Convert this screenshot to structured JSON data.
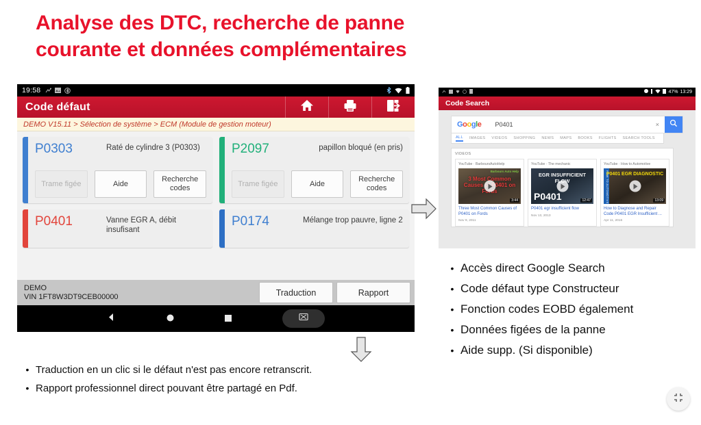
{
  "slide": {
    "title_line1": "Analyse des DTC, recherche de panne",
    "title_line2": "courante et données complémentaires",
    "title_color": "#e8122b"
  },
  "tablet": {
    "status_bar": {
      "clock": "19:58"
    },
    "header": {
      "title": "Code défaut"
    },
    "breadcrumb": "DEMO V15.11 > Sélection de système > ECM (Module de gestion moteur)",
    "dtc_cards": [
      {
        "code": "P0303",
        "description": "Raté de cylindre 3 (P0303)",
        "accent": "#3f7fd0",
        "code_color": "#3f7fd0",
        "buttons": {
          "freeze": "Trame figée",
          "help": "Aide",
          "search": "Recherche codes"
        }
      },
      {
        "code": "P2097",
        "description": "papillon bloqué (en pris)",
        "accent": "#21b07a",
        "code_color": "#21b07a",
        "buttons": {
          "freeze": "Trame figée",
          "help": "Aide",
          "search": "Recherche codes"
        }
      },
      {
        "code": "P0401",
        "description": "Vanne EGR A, débit insufisant",
        "accent": "#e2453c",
        "code_color": "#e2453c"
      },
      {
        "code": "P0174",
        "description": "Mélange trop pauvre, ligne 2",
        "accent": "#2d6fc4",
        "code_color": "#3f7fd0"
      }
    ],
    "footer": {
      "vehicle_line1": "DEMO",
      "vehicle_line2": "VIN 1FT8W3DT9CEB00000",
      "translate_label": "Traduction",
      "report_label": "Rapport"
    }
  },
  "phone": {
    "status_bar": {
      "battery": "47%",
      "clock": "13:29"
    },
    "header": {
      "title": "Code Search"
    },
    "search": {
      "logo_letters": [
        "G",
        "o",
        "o",
        "g",
        "l",
        "e"
      ],
      "query": "P0401",
      "clear_label": "×"
    },
    "tabs": [
      {
        "label": "ALL",
        "active": true
      },
      {
        "label": "IMAGES",
        "active": false
      },
      {
        "label": "VIDEOS",
        "active": false
      },
      {
        "label": "SHOPPING",
        "active": false
      },
      {
        "label": "NEWS",
        "active": false
      },
      {
        "label": "MAPS",
        "active": false
      },
      {
        "label": "BOOKS",
        "active": false
      },
      {
        "label": "FLIGHTS",
        "active": false
      },
      {
        "label": "SEARCH TOOLS",
        "active": false
      }
    ],
    "results": {
      "section_label": "VIDEOS",
      "videos": [
        {
          "source": "YouTube · BarboursAutoHelp",
          "thumb_text": "3 Most Common Causes of P0401 on Fords",
          "thumb_badge": "Barbours Auto Help",
          "duration": "3:44",
          "title": "Three Most Common Causes of P0401 on Fords",
          "date": "Nov 9, 2011"
        },
        {
          "source": "YouTube · The mechanic",
          "thumb_text": "EGR INSUFFICIENT FLOW",
          "thumb_big": "P0401",
          "duration": "12:47",
          "title": "P0401 egr insufficient flow",
          "date": "Nov 13, 2013"
        },
        {
          "source": "YouTube · How to Automotive",
          "thumb_text": "P0401 EGR DIAGNOSTIC",
          "thumb_side": "HOW TO AUTOMOTIVE",
          "duration": "13:09",
          "title": "How to Diagnose and Repair Code P0401 EGR Insufficient ...",
          "date": "Apr 11, 2016"
        }
      ]
    }
  },
  "bullets_right": [
    "Accès direct Google Search",
    "Code défaut type Constructeur",
    "Fonction codes EOBD également",
    "Données figées de la panne",
    "Aide supp. (Si disponible)"
  ],
  "bullets_bottom": [
    "Traduction en un clic si le défaut n'est pas encore retranscrit.",
    "Rapport professionnel direct pouvant être partagé en Pdf."
  ]
}
